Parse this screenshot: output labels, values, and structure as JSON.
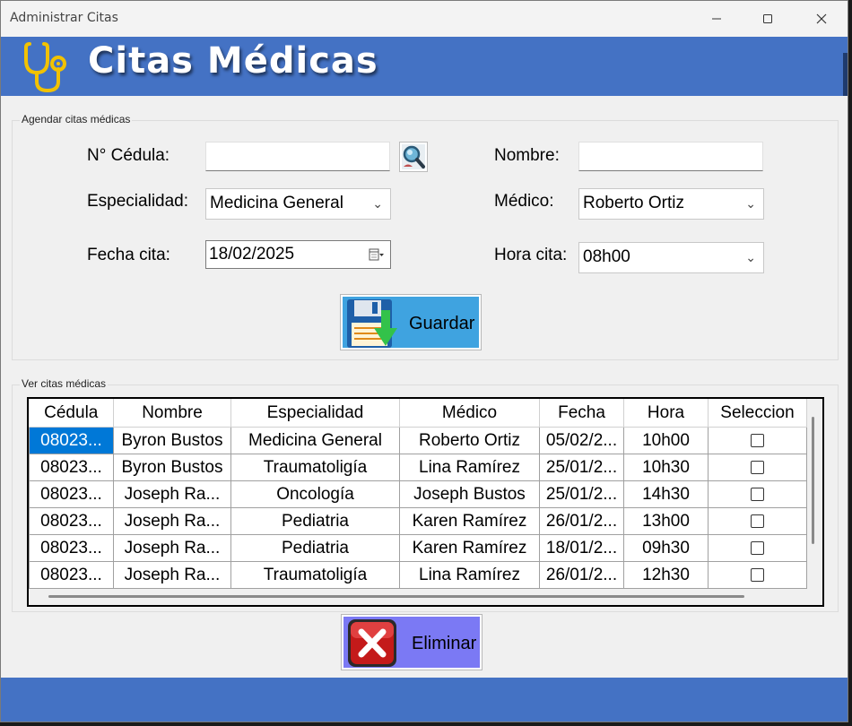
{
  "window": {
    "title": "Administrar Citas"
  },
  "header": {
    "title": "Citas Médicas",
    "icon": "stethoscope-icon",
    "bg_color": "#4472c4"
  },
  "form": {
    "legend": "Agendar citas médicas",
    "cedula_label": "N° Cédula:",
    "cedula_value": "",
    "nombre_label": "Nombre:",
    "nombre_value": "",
    "especialidad_label": "Especialidad:",
    "especialidad_value": "Medicina General",
    "medico_label": "Médico:",
    "medico_value": "Roberto Ortiz",
    "fecha_label": "Fecha cita:",
    "fecha_value": "18/02/2025",
    "hora_label": "Hora cita:",
    "hora_value": "08h00",
    "guardar_label": "Guardar"
  },
  "list": {
    "legend": "Ver citas médicas",
    "columns": [
      "Cédula",
      "Nombre",
      "Especialidad",
      "Médico",
      "Fecha",
      "Hora",
      "Seleccion"
    ],
    "rows": [
      [
        "08023...",
        "Byron Bustos",
        "Medicina General",
        "Roberto Ortiz",
        "05/02/2...",
        "10h00"
      ],
      [
        "08023...",
        "Byron Bustos",
        "Traumatoligía",
        "Lina Ramírez",
        "25/01/2...",
        "10h30"
      ],
      [
        "08023...",
        "Joseph Ra...",
        "Oncología",
        "Joseph Bustos",
        "25/01/2...",
        "14h30"
      ],
      [
        "08023...",
        "Joseph Ra...",
        "Pediatria",
        "Karen Ramírez",
        "26/01/2...",
        "13h00"
      ],
      [
        "08023...",
        "Joseph Ra...",
        "Pediatria",
        "Karen Ramírez",
        "18/01/2...",
        "09h30"
      ],
      [
        "08023...",
        "Joseph Ra...",
        "Traumatoligía",
        "Lina Ramírez",
        "26/01/2...",
        "12h30"
      ]
    ],
    "eliminar_label": "Eliminar"
  },
  "colors": {
    "header": "#4472c4",
    "guardar": "#3fa3e0",
    "eliminar": "#7b79f4",
    "selection": "#0078d7"
  }
}
